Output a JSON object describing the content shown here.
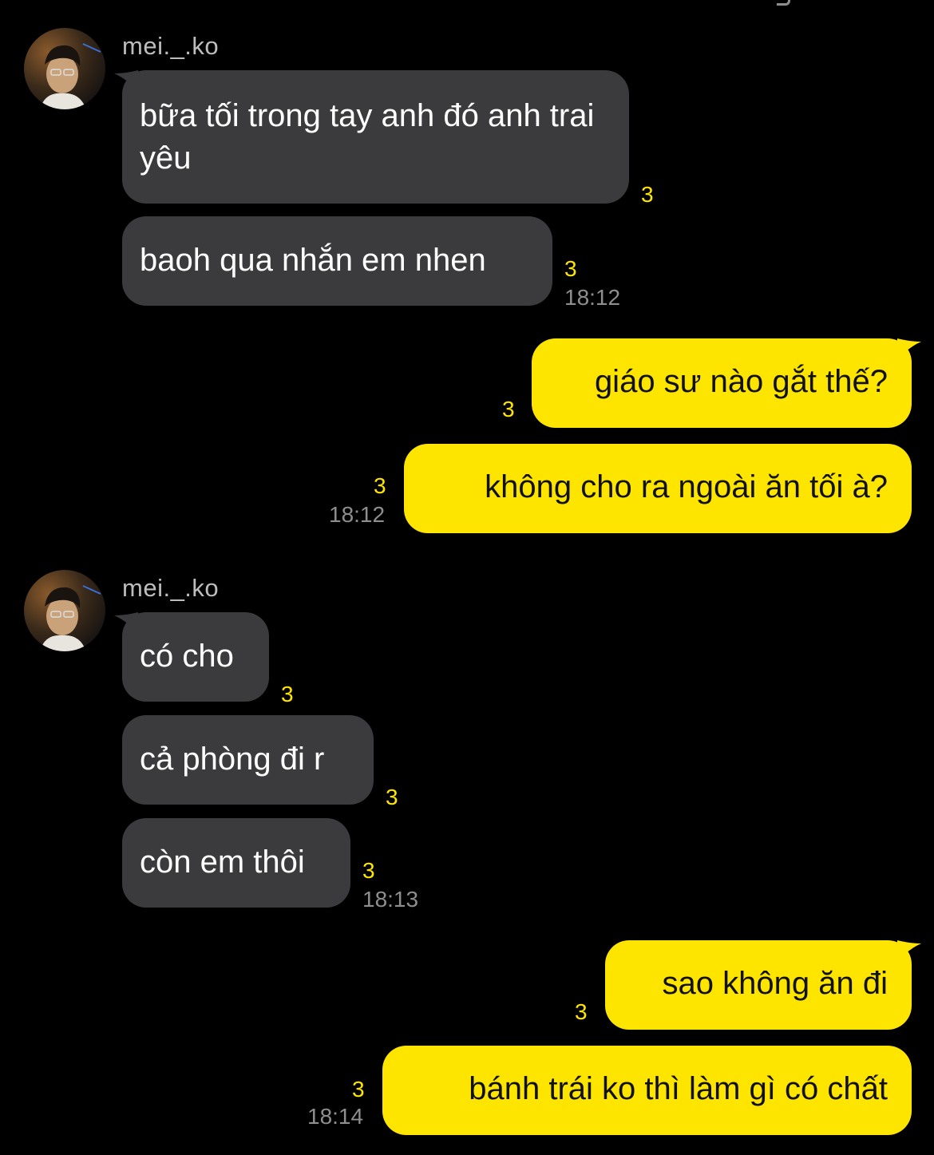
{
  "colors": {
    "background": "#000000",
    "incoming_bubble": "#3b3b3d",
    "outgoing_bubble": "#fee500",
    "unread_count": "#fee500",
    "timestamp": "#8e8e8e"
  },
  "groups": [
    {
      "sender": "mei._.ko",
      "avatar": "avatar-photo",
      "messages": [
        {
          "text": "bữa tối trong tay anh đó anh trai yêu",
          "unread": "3",
          "time": ""
        },
        {
          "text": "baoh qua nhắn em nhen",
          "unread": "3",
          "time": "18:12"
        }
      ]
    },
    {
      "sender": "me",
      "messages": [
        {
          "text": "giáo sư nào gắt thế?",
          "unread": "3",
          "time": ""
        },
        {
          "text": "không cho ra ngoài ăn tối à?",
          "unread": "3",
          "time": "18:12"
        }
      ]
    },
    {
      "sender": "mei._.ko",
      "avatar": "avatar-photo",
      "messages": [
        {
          "text": "có cho",
          "unread": "3",
          "time": ""
        },
        {
          "text": "cả phòng đi r",
          "unread": "3",
          "time": ""
        },
        {
          "text": "còn em thôi",
          "unread": "3",
          "time": "18:13"
        }
      ]
    },
    {
      "sender": "me",
      "messages": [
        {
          "text": "sao không ăn đi",
          "unread": "3",
          "time": ""
        },
        {
          "text": "bánh trái ko thì làm gì có chất",
          "unread": "3",
          "time": "18:14"
        }
      ]
    }
  ]
}
